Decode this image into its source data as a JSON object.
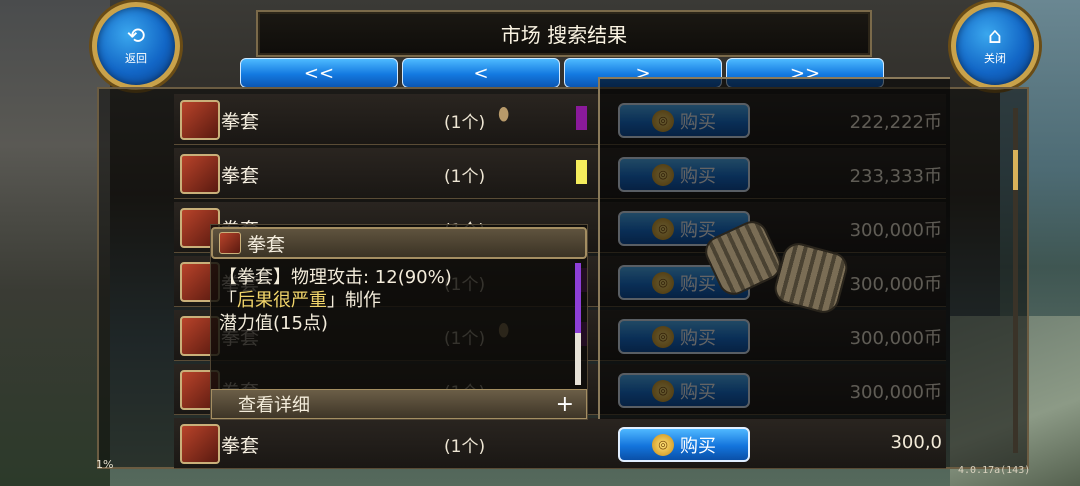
{
  "header": {
    "title": "市场 搜索结果",
    "back_label": "返回",
    "back_icon": "return-arrow-icon",
    "close_label": "关闭",
    "close_icon": "home-icon"
  },
  "pager": {
    "first": "<<",
    "prev": "<",
    "next": ">",
    "last": ">>"
  },
  "listings": [
    {
      "name": "拳套",
      "qty": "(1个)",
      "has_pouch": true,
      "quality_color": "#8a1a9a",
      "buy_label": "购买",
      "price": "222,222币"
    },
    {
      "name": "拳套",
      "qty": "(1个)",
      "has_pouch": false,
      "quality_color": "#f4ec5c",
      "buy_label": "购买",
      "price": "233,333币"
    },
    {
      "name": "拳套",
      "qty": "(1个)",
      "has_pouch": false,
      "quality_color": "",
      "buy_label": "购买",
      "price": "300,000币"
    },
    {
      "name": "拳套",
      "qty": "(1个)",
      "has_pouch": false,
      "quality_color": "#8a1a9a",
      "buy_label": "购买",
      "price": "300,000币"
    },
    {
      "name": "拳套",
      "qty": "(1个)",
      "has_pouch": true,
      "quality_color": "#8a1a9a",
      "buy_label": "购买",
      "price": "300,000币"
    },
    {
      "name": "拳套",
      "qty": "(1个)",
      "has_pouch": false,
      "quality_color": "",
      "buy_label": "购买",
      "price": "300,000币"
    },
    {
      "name": "拳套",
      "qty": "(1个)",
      "has_pouch": false,
      "quality_color": "",
      "buy_label": "购买",
      "price": "300,0"
    }
  ],
  "tooltip": {
    "title": "拳套",
    "stat_line": "【拳套】物理攻击: 12(90%)",
    "maker_prefix": "「",
    "maker_name": "后果很严重",
    "maker_suffix": "」制作",
    "potential": "潜力值(15点)",
    "footer_label": "查看详细",
    "footer_action": "+",
    "scroll_fraction": 0.57
  },
  "status": {
    "percent": "1%",
    "version": "4.0.17a(143)"
  },
  "colors": {
    "accent_blue": "#1374dc",
    "gold": "#c9a24a",
    "epic_purple": "#8a1a9a",
    "rare_yellow": "#f4ec5c"
  }
}
